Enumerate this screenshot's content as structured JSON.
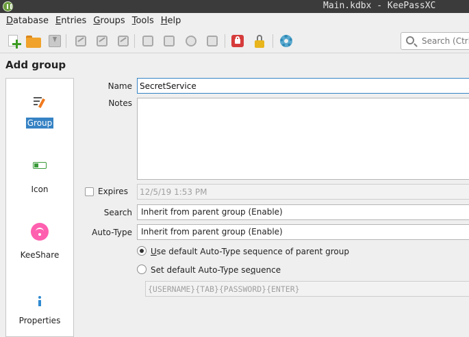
{
  "window": {
    "title": "Main.kdbx - KeePassXC"
  },
  "menubar": {
    "items": [
      {
        "label": "Database",
        "mnemonic": "D",
        "rest": "atabase"
      },
      {
        "label": "Entries",
        "mnemonic": "E",
        "rest": "ntries"
      },
      {
        "label": "Groups",
        "mnemonic": "G",
        "rest": "roups"
      },
      {
        "label": "Tools",
        "mnemonic": "T",
        "rest": "ools"
      },
      {
        "label": "Help",
        "mnemonic": "H",
        "rest": "elp"
      }
    ]
  },
  "toolbar": {
    "icons": [
      "new-database-icon",
      "open-database-icon",
      "save-database-icon",
      "add-entry-icon",
      "edit-entry-icon",
      "delete-entry-icon",
      "copy-username-icon",
      "copy-password-icon",
      "copy-url-icon",
      "perform-autotype-icon",
      "lock-database-icon",
      "password-generator-icon",
      "settings-icon"
    ],
    "search_placeholder": "Search (Ctrl+F)..."
  },
  "page": {
    "title": "Add group"
  },
  "categories": [
    {
      "label": "Group",
      "icon": "edit-icon",
      "selected": true
    },
    {
      "label": "Icon",
      "icon": "battery-icon",
      "selected": false
    },
    {
      "label": "KeeShare",
      "icon": "wifi-share-icon",
      "selected": false
    },
    {
      "label": "Properties",
      "icon": "info-icon",
      "selected": false
    }
  ],
  "form": {
    "name_label": "Name",
    "name_value": "SecretService",
    "notes_label": "Notes",
    "notes_value": "",
    "expires_label": "Expires",
    "expires_checked": false,
    "expires_value": "12/5/19 1:53 PM",
    "search_label": "Search",
    "search_value": "Inherit from parent group (Enable)",
    "autotype_label": "Auto-Type",
    "autotype_value": "Inherit from parent group (Enable)",
    "radio_default_label_pre": "",
    "radio_default_mnemonic": "U",
    "radio_default_label_post": "se default Auto-Type sequence of parent group",
    "radio_custom_label_pre": "Set default Auto-Type se",
    "radio_custom_mnemonic": "q",
    "radio_custom_label_post": "uence",
    "sequence_value": "{USERNAME}{TAB}{PASSWORD}{ENTER}"
  },
  "colors": {
    "accent": "#3582c4",
    "titlebar": "#3b3b3b",
    "keeshare": "#ff5faf"
  }
}
